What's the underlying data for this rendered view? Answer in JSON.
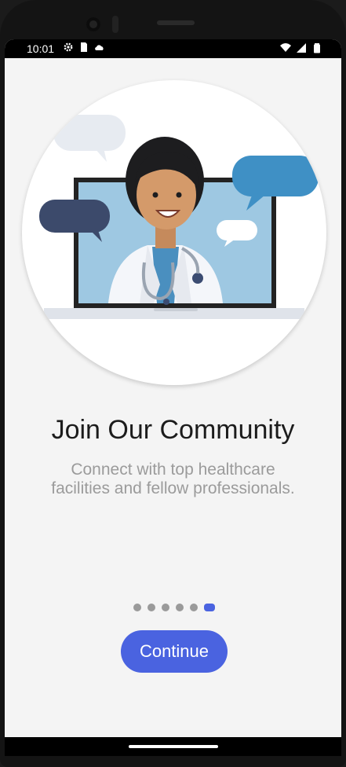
{
  "status_bar": {
    "time": "10:01",
    "left_icons": [
      "settings-icon",
      "sim-card-icon",
      "cloud-icon"
    ],
    "right_icons": [
      "wifi-icon",
      "signal-icon",
      "battery-icon"
    ]
  },
  "onboarding": {
    "illustration": "doctor-video-call-illustration",
    "title": "Join Our Community",
    "subtitle_line1": "Connect with top healthcare",
    "subtitle_line2": "facilities and fellow professionals.",
    "page_indicator": {
      "total": 6,
      "current": 6
    },
    "continue_label": "Continue"
  },
  "colors": {
    "accent": "#4a63e0",
    "background": "#f4f4f4",
    "title": "#1c1c1c",
    "subtitle": "#9b9b9b"
  }
}
